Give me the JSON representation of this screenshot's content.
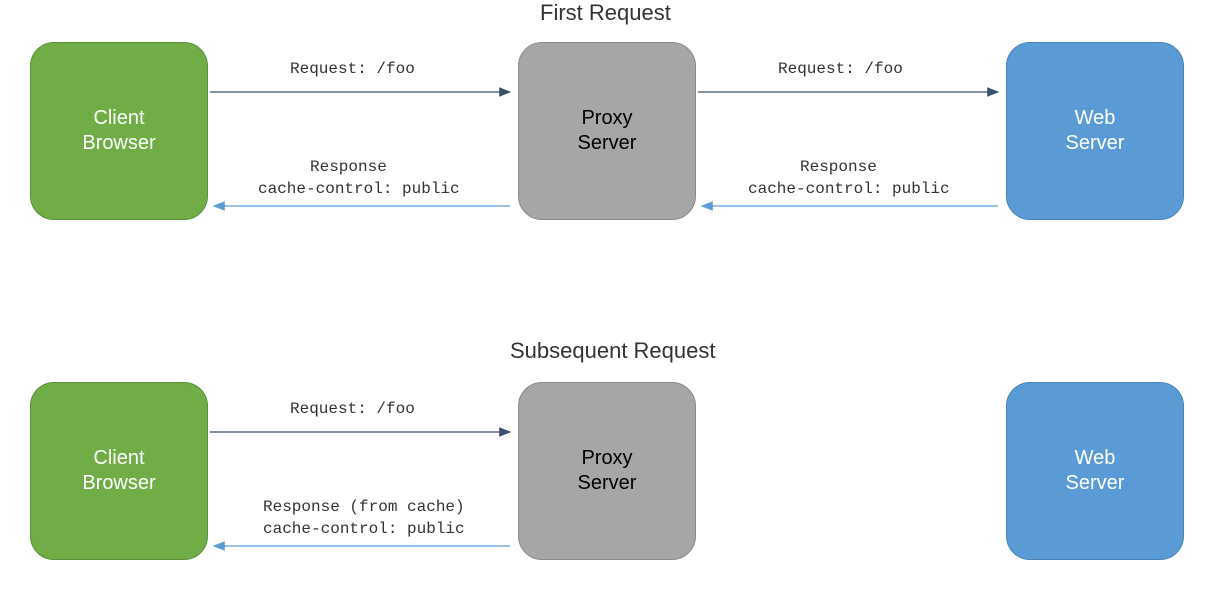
{
  "section1": {
    "title": "First Request",
    "client": {
      "line1": "Client",
      "line2": "Browser"
    },
    "proxy": {
      "line1": "Proxy",
      "line2": "Server"
    },
    "web": {
      "line1": "Web",
      "line2": "Server"
    },
    "req_left": "Request: /foo",
    "req_right": "Request: /foo",
    "resp_left_l1": "Response",
    "resp_left_l2": "cache-control: public",
    "resp_right_l1": "Response",
    "resp_right_l2": "cache-control: public"
  },
  "section2": {
    "title": "Subsequent Request",
    "client": {
      "line1": "Client",
      "line2": "Browser"
    },
    "proxy": {
      "line1": "Proxy",
      "line2": "Server"
    },
    "web": {
      "line1": "Web",
      "line2": "Server"
    },
    "req_left": "Request: /foo",
    "resp_left_l1": "Response (from cache)",
    "resp_left_l2": "cache-control: public"
  },
  "colors": {
    "client": "#70AD47",
    "proxy": "#A6A6A6",
    "web": "#5B9BD5",
    "req_arrow": "#3a506b",
    "resp_arrow": "#5B9BD5"
  }
}
